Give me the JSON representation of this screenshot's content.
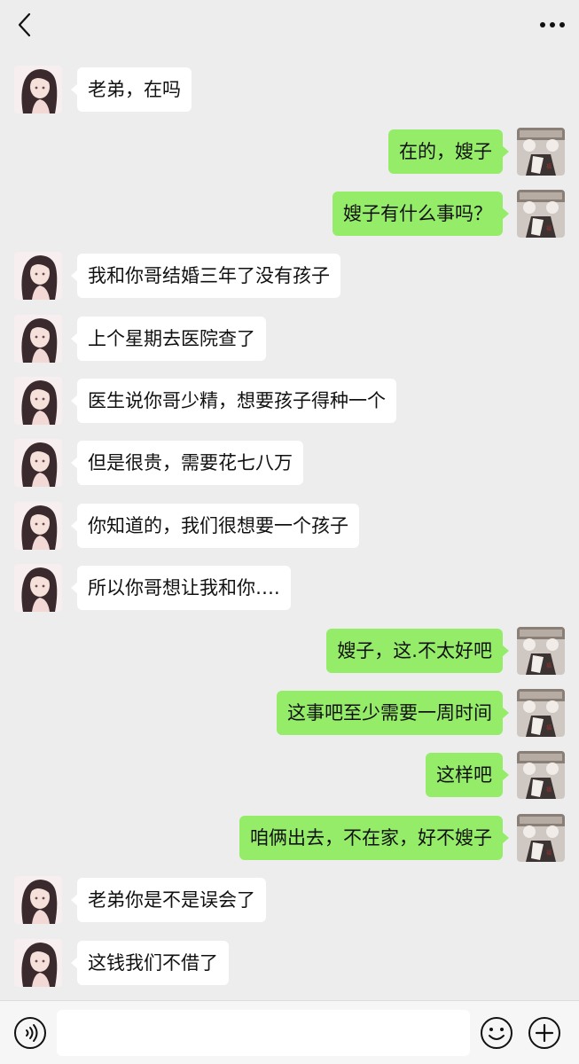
{
  "header": {
    "back_icon": "chevron-left-icon",
    "more_icon": "more-horizontal-icon"
  },
  "messages": [
    {
      "side": "left",
      "text": "老弟，在吗"
    },
    {
      "side": "right",
      "text": "在的，嫂子"
    },
    {
      "side": "right",
      "text": "嫂子有什么事吗？"
    },
    {
      "side": "left",
      "text": "我和你哥结婚三年了没有孩子"
    },
    {
      "side": "left",
      "text": "上个星期去医院查了"
    },
    {
      "side": "left",
      "text": "医生说你哥少精，想要孩子得种一个"
    },
    {
      "side": "left",
      "text": "但是很贵，需要花七八万"
    },
    {
      "side": "left",
      "text": "你知道的，我们很想要一个孩子"
    },
    {
      "side": "left",
      "text": "所以你哥想让我和你…."
    },
    {
      "side": "right",
      "text": "嫂子，这.不太好吧"
    },
    {
      "side": "right",
      "text": "这事吧至少需要一周时间"
    },
    {
      "side": "right",
      "text": "这样吧"
    },
    {
      "side": "right",
      "text": "咱俩出去，不在家，好不嫂子"
    },
    {
      "side": "left",
      "text": "老弟你是不是误会了"
    },
    {
      "side": "left",
      "text": "这钱我们不借了"
    }
  ],
  "input_bar": {
    "text_value": "",
    "voice_icon": "voice-icon",
    "emoji_icon": "emoji-icon",
    "plus_icon": "plus-icon"
  },
  "colors": {
    "background": "#ededed",
    "sent_bubble": "#95ec69",
    "received_bubble": "#ffffff"
  }
}
